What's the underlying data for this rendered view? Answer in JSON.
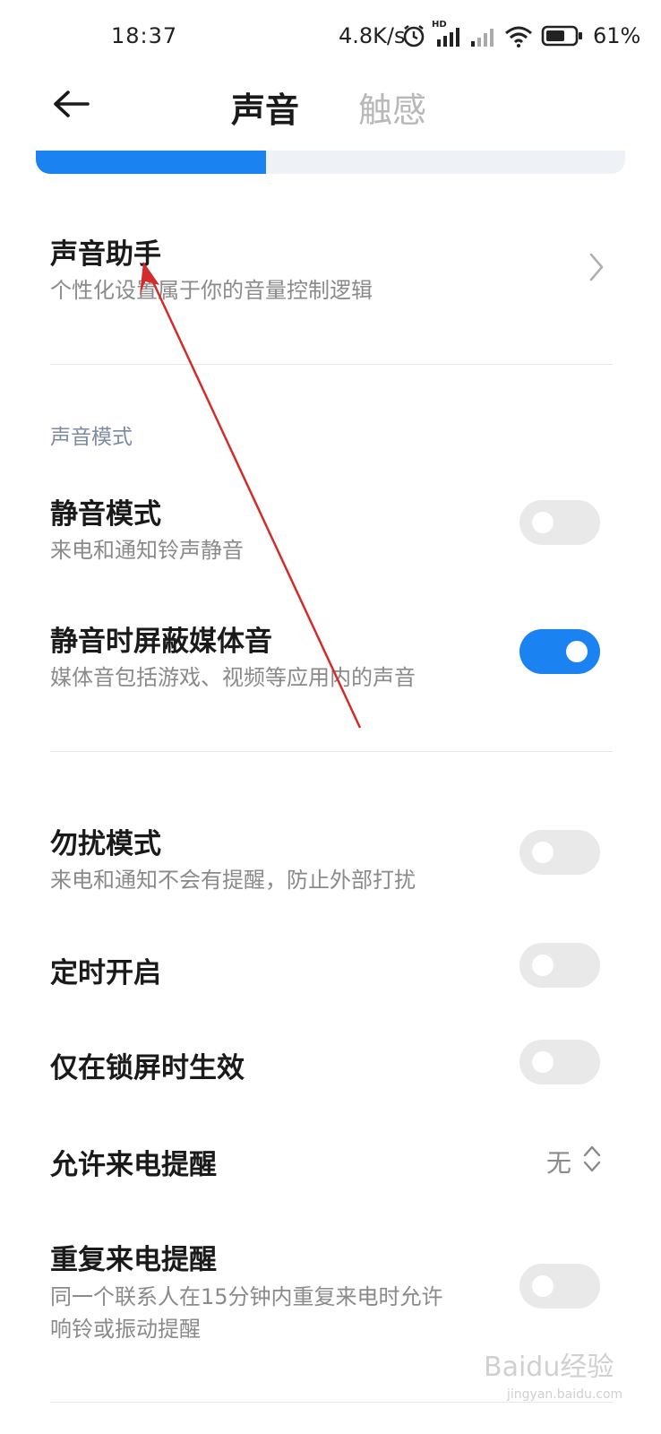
{
  "status_bar": {
    "time": "18:37",
    "network_speed": "4.8K/s",
    "hd_label": "HD",
    "battery_percent": "61%"
  },
  "header": {
    "tabs": [
      {
        "label": "声音",
        "active": true
      },
      {
        "label": "触感",
        "active": false
      }
    ]
  },
  "volume_level": 0.39,
  "sound_assistant": {
    "title": "声音助手",
    "subtitle": "个性化设置属于你的音量控制逻辑"
  },
  "section_label": "声音模式",
  "rows": {
    "silent_mode": {
      "title": "静音模式",
      "subtitle": "来电和通知铃声静音",
      "enabled": false
    },
    "mute_media": {
      "title": "静音时屏蔽媒体音",
      "subtitle": "媒体音包括游戏、视频等应用内的声音",
      "enabled": true
    },
    "dnd": {
      "title": "勿扰模式",
      "subtitle": "来电和通知不会有提醒，防止外部打扰",
      "enabled": false
    },
    "scheduled": {
      "title": "定时开启",
      "enabled": false
    },
    "lock_only": {
      "title": "仅在锁屏时生效",
      "enabled": false
    },
    "allow_calls": {
      "title": "允许来电提醒",
      "value": "无"
    },
    "repeat_calls": {
      "title": "重复来电提醒",
      "subtitle_line1": "同一个联系人在15分钟内重复来电时允许",
      "subtitle_line2": "响铃或振动提醒",
      "enabled": false
    }
  },
  "watermark": {
    "brand": "Baidu经验",
    "url": "jingyan.baidu.com"
  },
  "colors": {
    "accent": "#1b82f2",
    "annotation_arrow": "#d42a2a"
  }
}
